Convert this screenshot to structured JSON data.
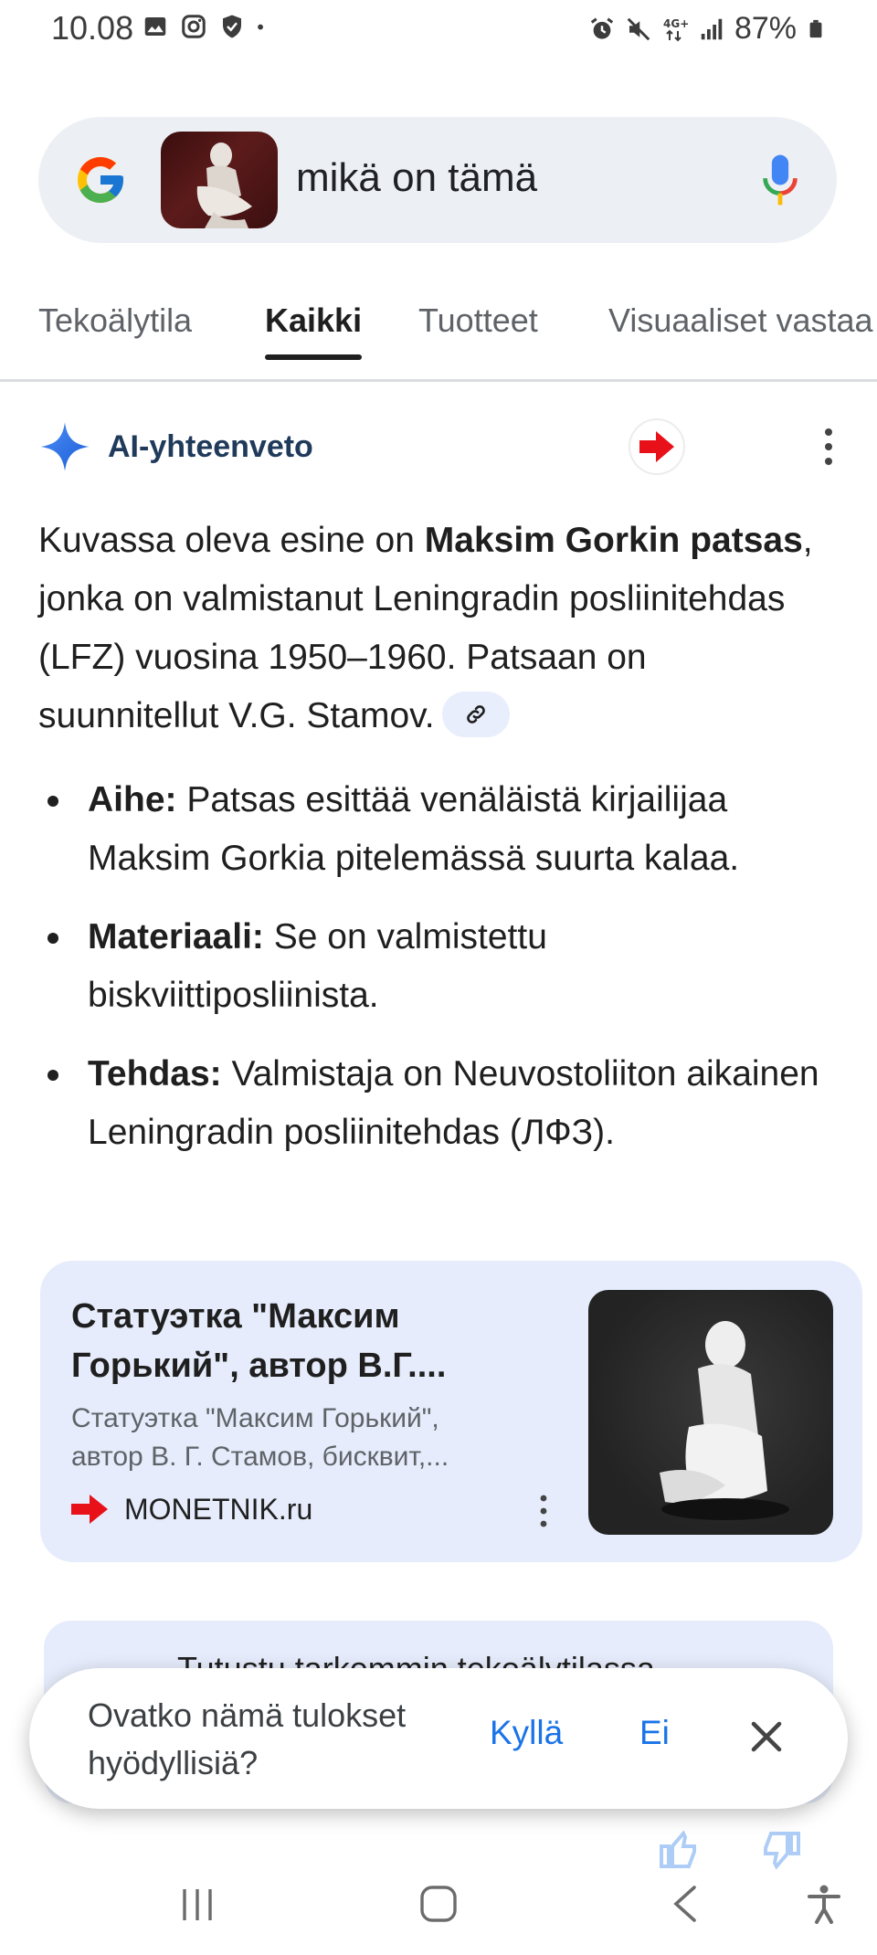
{
  "status_bar": {
    "time": "10.08",
    "battery": "87%",
    "icons": [
      "image-icon",
      "instagram-icon",
      "shield-icon",
      "dot-icon",
      "alarm-icon",
      "mute-icon",
      "4g-icon",
      "signal-icon",
      "battery-icon"
    ]
  },
  "search": {
    "query": "mikä on tämä"
  },
  "tabs": [
    {
      "label": "Tekoälytila",
      "active": false
    },
    {
      "label": "Kaikki",
      "active": true
    },
    {
      "label": "Tuotteet",
      "active": false
    },
    {
      "label": "Visuaaliset vastaa",
      "active": false
    }
  ],
  "ai_overview": {
    "title": "AI-yhteenveto",
    "para_intro": "Kuvassa oleva esine on ",
    "para_bold": "Maksim Gorkin patsas",
    "para_rest": ", jonka on valmistanut Leningradin posliinitehdas (LFZ) vuosina 1950–1960. Patsaan on suunnitellut V.G. Stamov.",
    "bullets": [
      {
        "label": "Aihe:",
        "text": " Patsas esittää venäläistä kirjailijaa Maksim Gorkia pitelemässä suurta kalaa."
      },
      {
        "label": "Materiaali:",
        "text": " Se on valmistettu biskviittiposliinista."
      },
      {
        "label": "Tehdas:",
        "text": " Valmistaja on Neuvostoliiton aikainen Leningradin posliinitehdas (ЛФЗ)."
      }
    ]
  },
  "result": {
    "title": "Статуэтка \"Максим Горький\", автор В.Г....",
    "snippet": "Статуэтка \"Максим Горький\", автор В. Г. Стамов, бисквит,...",
    "source": "MONETNIK.ru"
  },
  "next_card": {
    "text": "Tutustu tarkemmin tekoälytilassa"
  },
  "feedback": {
    "question": "Ovatko nämä tulokset hyödyllisiä?",
    "yes": "Kyllä",
    "no": "Ei"
  },
  "colors": {
    "accent_blue": "#1a73e8",
    "card_bg": "#e6ecfb",
    "search_bg": "#eceff3"
  }
}
